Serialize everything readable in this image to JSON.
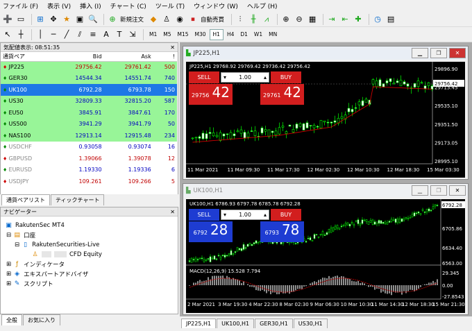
{
  "menu": [
    "ファイル (F)",
    "表示 (V)",
    "挿入 (I)",
    "チャート (C)",
    "ツール (T)",
    "ウィンドウ (W)",
    "ヘルプ (H)"
  ],
  "toolbar": {
    "new_order": "新規注文",
    "autotrade": "自動売買"
  },
  "timeframes": [
    "M1",
    "M5",
    "M15",
    "M30",
    "H1",
    "H4",
    "D1",
    "W1",
    "MN"
  ],
  "active_timeframe": "H1",
  "marketwatch": {
    "title": "気配値表示: 08:51:35",
    "columns": [
      "通貨ペア",
      "Bid",
      "Ask",
      "!"
    ],
    "rows": [
      {
        "symbol": "JP225",
        "bid": "29756.42",
        "ask": "29761.42",
        "spread": "500",
        "bg": "#98f598",
        "col": "#c00000"
      },
      {
        "symbol": "GER30",
        "bid": "14544.34",
        "ask": "14551.74",
        "spread": "740",
        "bg": "#98f598",
        "col": "#0000c0"
      },
      {
        "symbol": "UK100",
        "bid": "6792.28",
        "ask": "6793.78",
        "spread": "150",
        "bg": "#1e78e6",
        "col": "#ffffff"
      },
      {
        "symbol": "US30",
        "bid": "32809.33",
        "ask": "32815.20",
        "spread": "587",
        "bg": "#98f598",
        "col": "#0000c0"
      },
      {
        "symbol": "EU50",
        "bid": "3845.91",
        "ask": "3847.61",
        "spread": "170",
        "bg": "#98f598",
        "col": "#0000c0"
      },
      {
        "symbol": "US500",
        "bid": "3941.29",
        "ask": "3941.79",
        "spread": "50",
        "bg": "#98f598",
        "col": "#0000c0"
      },
      {
        "symbol": "NAS100",
        "bid": "12913.14",
        "ask": "12915.48",
        "spread": "234",
        "bg": "#98f598",
        "col": "#0000c0"
      },
      {
        "symbol": "USDCHF",
        "bid": "0.93058",
        "ask": "0.93074",
        "spread": "16",
        "bg": "#ffffff",
        "col": "#0000c0"
      },
      {
        "symbol": "GBPUSD",
        "bid": "1.39066",
        "ask": "1.39078",
        "spread": "12",
        "bg": "#ffffff",
        "col": "#c00000"
      },
      {
        "symbol": "EURUSD",
        "bid": "1.19330",
        "ask": "1.19336",
        "spread": "6",
        "bg": "#ffffff",
        "col": "#0000c0"
      },
      {
        "symbol": "USDJPY",
        "bid": "109.261",
        "ask": "109.266",
        "spread": "5",
        "bg": "#ffffff",
        "col": "#c00000"
      }
    ],
    "tabs": [
      "通貨ペアリスト",
      "ティックチャート"
    ]
  },
  "navigator": {
    "title": "ナビゲーター",
    "root": "RakutenSec MT4",
    "account": "口座",
    "server": "RakutenSecurities-Live",
    "cfd": "CFD Equity",
    "indicators": "インディケータ",
    "experts": "エキスパートアドバイザ",
    "scripts": "スクリプト",
    "tabs": [
      "全般",
      "お気に入り"
    ]
  },
  "chart1": {
    "window_title": "JP225,H1",
    "info": "JP225,H1  29768.92 29769.42 29736.42 29756.42",
    "sell": "SELL",
    "buy": "BUY",
    "lot": "1.00",
    "sell_small": "29756",
    "sell_big": "42",
    "buy_small": "29761",
    "buy_big": "42",
    "price_labels": [
      "29896.90",
      "29713.45",
      "29535.10",
      "29351.50",
      "29173.05",
      "28995.10"
    ],
    "current_price": "29756.42",
    "time_labels": [
      "11 Mar 2021",
      "11 Mar 09:30",
      "11 Mar 17:30",
      "12 Mar 02:30",
      "12 Mar 10:30",
      "12 Mar 18:30",
      "15 Mar 03:30"
    ]
  },
  "chart2": {
    "window_title": "UK100,H1",
    "info": "UK100,H1  6786.93 6797.78 6785.78 6792.28",
    "sell": "SELL",
    "buy": "BUY",
    "lot": "1.00",
    "sell_small": "6792",
    "sell_big": "28",
    "buy_small": "6793",
    "buy_big": "78",
    "price_labels": [
      "6792.28",
      "6705.86",
      "6634.40",
      "6563.00"
    ],
    "macd_label": "MACD(12,26,9) 15.528 7.794",
    "macd_levels": [
      "29.345",
      "0.00",
      "-27.8543"
    ],
    "time_labels": [
      "2 Mar 2021",
      "3 Mar 19:30",
      "4 Mar 22:30",
      "8 Mar 02:30",
      "9 Mar 06:30",
      "10 Mar 10:30",
      "11 Mar 14:30",
      "12 Mar 18:30",
      "15 Mar 21:30"
    ]
  },
  "chart_tabs": [
    "JP225,H1",
    "UK100,H1",
    "GER30,H1",
    "US30,H1"
  ],
  "colors": {
    "bull": "#00ff00",
    "bear": "#000000",
    "ma": "#cc0000",
    "sell": "#d21e1e",
    "buy": "#d21e1e",
    "blue_sell": "#1e3cd2"
  }
}
